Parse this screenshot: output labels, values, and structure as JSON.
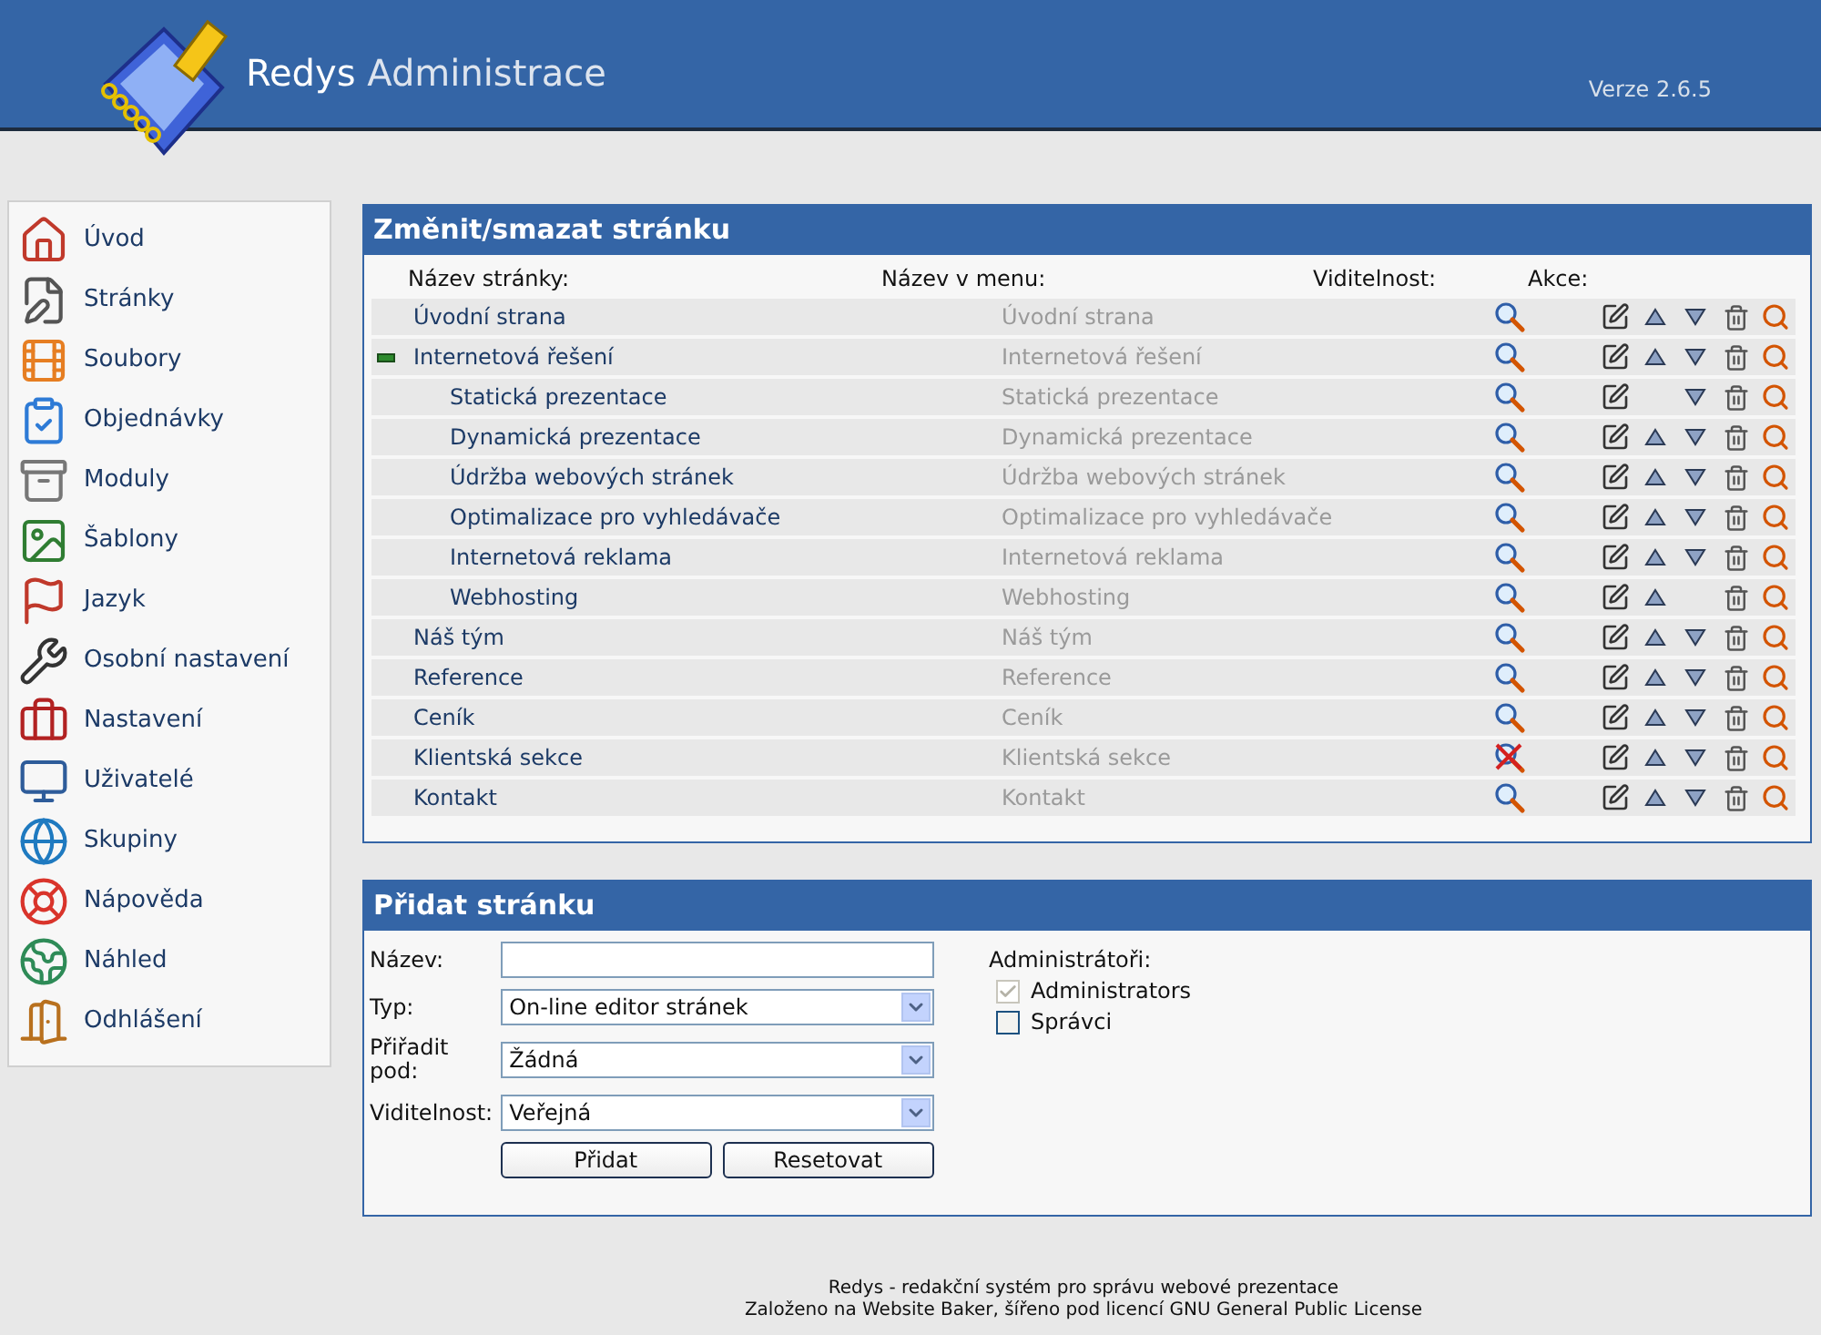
{
  "header": {
    "title_bold": "Redys",
    "title_rest": "Administrace",
    "version": "Verze 2.6.5"
  },
  "sidebar": {
    "items": [
      {
        "label": "Úvod"
      },
      {
        "label": "Stránky"
      },
      {
        "label": "Soubory"
      },
      {
        "label": "Objednávky"
      },
      {
        "label": "Moduly"
      },
      {
        "label": "Šablony"
      },
      {
        "label": "Jazyk"
      },
      {
        "label": "Osobní nastavení"
      },
      {
        "label": "Nastavení"
      },
      {
        "label": "Uživatelé"
      },
      {
        "label": "Skupiny"
      },
      {
        "label": "Nápověda"
      },
      {
        "label": "Náhled"
      },
      {
        "label": "Odhlášení"
      }
    ]
  },
  "pages_panel": {
    "title": "Změnit/smazat stránku",
    "columns": [
      "Název stránky:",
      "Název v menu:",
      "Viditelnost:",
      "Akce:"
    ],
    "rows": [
      {
        "name": "Úvodní strana",
        "menu_title": "Úvodní strana",
        "visible": true,
        "can_move_up": true,
        "can_move_down": true
      },
      {
        "name": "Internetová řešení",
        "menu_title": "Internetová řešení",
        "visible": true,
        "can_move_up": true,
        "can_move_down": true,
        "expanded": true,
        "children": [
          {
            "name": "Statická prezentace",
            "menu_title": "Statická prezentace",
            "visible": true,
            "can_move_up": false,
            "can_move_down": true
          },
          {
            "name": "Dynamická prezentace",
            "menu_title": "Dynamická prezentace",
            "visible": true,
            "can_move_up": true,
            "can_move_down": true
          },
          {
            "name": "Údržba webových stránek",
            "menu_title": "Údržba webových stránek",
            "visible": true,
            "can_move_up": true,
            "can_move_down": true
          },
          {
            "name": "Optimalizace pro vyhledávače",
            "menu_title": "Optimalizace pro vyhledávače",
            "visible": true,
            "can_move_up": true,
            "can_move_down": true
          },
          {
            "name": "Internetová reklama",
            "menu_title": "Internetová reklama",
            "visible": true,
            "can_move_up": true,
            "can_move_down": true
          },
          {
            "name": "Webhosting",
            "menu_title": "Webhosting",
            "visible": true,
            "can_move_up": true,
            "can_move_down": false
          }
        ]
      },
      {
        "name": "Náš tým",
        "menu_title": "Náš tým",
        "visible": true,
        "can_move_up": true,
        "can_move_down": true
      },
      {
        "name": "Reference",
        "menu_title": "Reference",
        "visible": true,
        "can_move_up": true,
        "can_move_down": true
      },
      {
        "name": "Ceník",
        "menu_title": "Ceník",
        "visible": true,
        "can_move_up": true,
        "can_move_down": true
      },
      {
        "name": "Klientská sekce",
        "menu_title": "Klientská sekce",
        "visible": false,
        "can_move_up": true,
        "can_move_down": true
      },
      {
        "name": "Kontakt",
        "menu_title": "Kontakt",
        "visible": true,
        "can_move_up": true,
        "can_move_down": true
      }
    ]
  },
  "add_panel": {
    "title": "Přidat stránku",
    "fields": [
      {
        "kind": "text",
        "label": "Název:"
      },
      {
        "kind": "select",
        "label": "Typ:",
        "value": "On-line editor stránek"
      },
      {
        "kind": "select",
        "label": "Přiřadit pod:",
        "value": "Žádná"
      },
      {
        "kind": "select",
        "label": "Viditelnost:",
        "value": "Veřejná"
      }
    ],
    "buttons": [
      "Přidat",
      "Resetovat"
    ],
    "admins": {
      "label": "Administrátoři:",
      "groups": [
        {
          "label": "Administrators",
          "checked": true,
          "disabled": true
        },
        {
          "label": "Správci",
          "checked": false,
          "disabled": false
        }
      ]
    }
  },
  "footer": [
    "Redys - redakční systém pro správu webové prezentace",
    "Založeno na Website Baker, šířeno pod licencí GNU General Public License"
  ]
}
